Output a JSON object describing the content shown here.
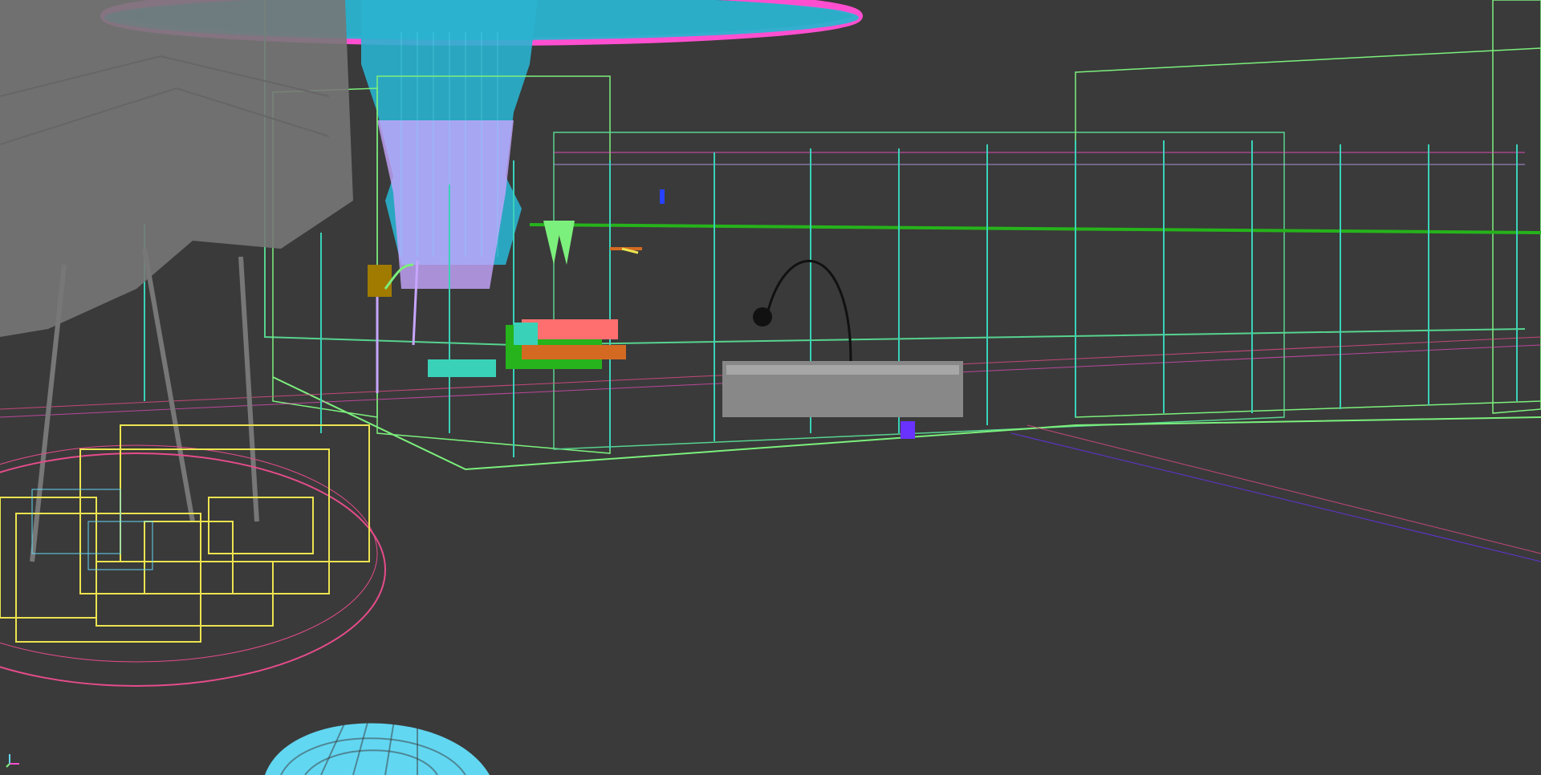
{
  "viewport": {
    "background": "#3a3a3a",
    "render_mode": "wireframe",
    "colors": {
      "cyan": "#2ab3cf",
      "light_cyan": "#62d7f2",
      "magenta": "#ff4fd0",
      "pink": "#e64c8a",
      "green": "#57d38f",
      "lime": "#7cf07c",
      "dark_green": "#26b31b",
      "yellow": "#ece34f",
      "gray": "#777777",
      "lavender": "#c7a6ff",
      "teal": "#39d2b8",
      "bed_red": "#ff6f6f",
      "bed_orange": "#d46a22",
      "blue": "#2742ff",
      "purple": "#6a32ff",
      "black": "#111111"
    },
    "icons": {
      "axis": "axis-tripod-icon"
    }
  }
}
